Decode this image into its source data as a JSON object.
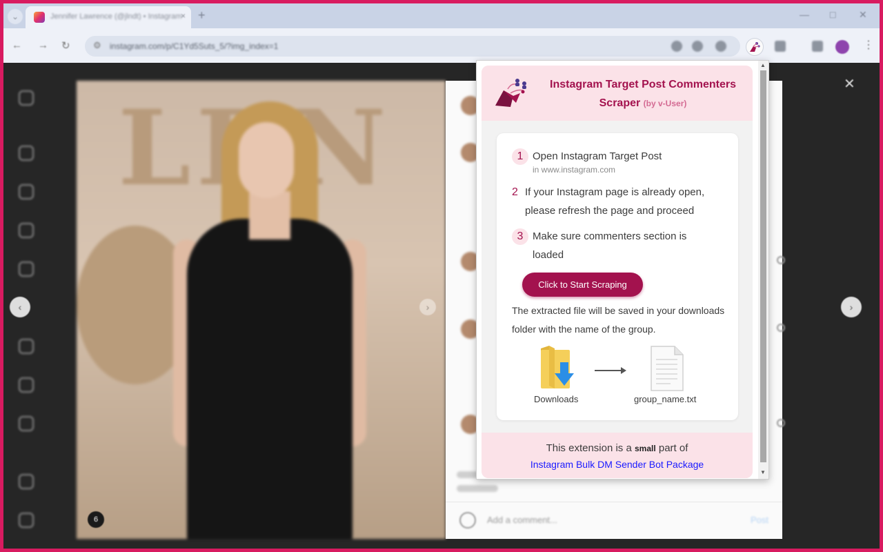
{
  "browser": {
    "tab_title": "Jennifer Lawrence (@jlndt) • Instagram",
    "tab_close": "×",
    "new_tab": "+",
    "url": "instagram.com/p/C1Yd5Suts_5/?img_index=1",
    "nav": {
      "back": "←",
      "forward": "→",
      "reload": "↻"
    },
    "window": {
      "minimize": "—",
      "maximize": "□",
      "close": "✕"
    }
  },
  "page": {
    "close": "✕",
    "prev": "‹",
    "next": "›",
    "image_index": "6",
    "comment_placeholder": "Add a comment...",
    "post_label": "Post"
  },
  "popup": {
    "title_line1": "Instagram Target Post Commenters",
    "title_line2": "Scraper",
    "title_by": "(by v-User)",
    "steps": [
      {
        "num": "1",
        "text": "Open Instagram Target Post",
        "sub": "in www.instagram.com"
      },
      {
        "num": "2",
        "text_line1": "If your Instagram page is already open,",
        "text_line2": "please refresh the page and proceed"
      },
      {
        "num": "3",
        "text_line1": "Make sure commenters section is",
        "text_line2": "loaded"
      }
    ],
    "start_button": "Click to Start Scraping",
    "note": "The extracted file will be saved in your downloads folder with the name of the group.",
    "downloads_label": "Downloads",
    "file_label": "group_name.txt",
    "footer_prefix": "This extension is a",
    "footer_small": "small",
    "footer_suffix": "part of",
    "footer_link": "Instagram Bulk DM Sender Bot Package"
  },
  "colors": {
    "brand": "#a3124e",
    "header_bg": "#fbe2e8",
    "link": "#1a1aff",
    "outer_border": "#d81b60"
  },
  "icons": [
    "instagram-favicon",
    "extension-scraper-icon",
    "folder-download-icon",
    "arrow-right-icon",
    "text-file-icon"
  ]
}
